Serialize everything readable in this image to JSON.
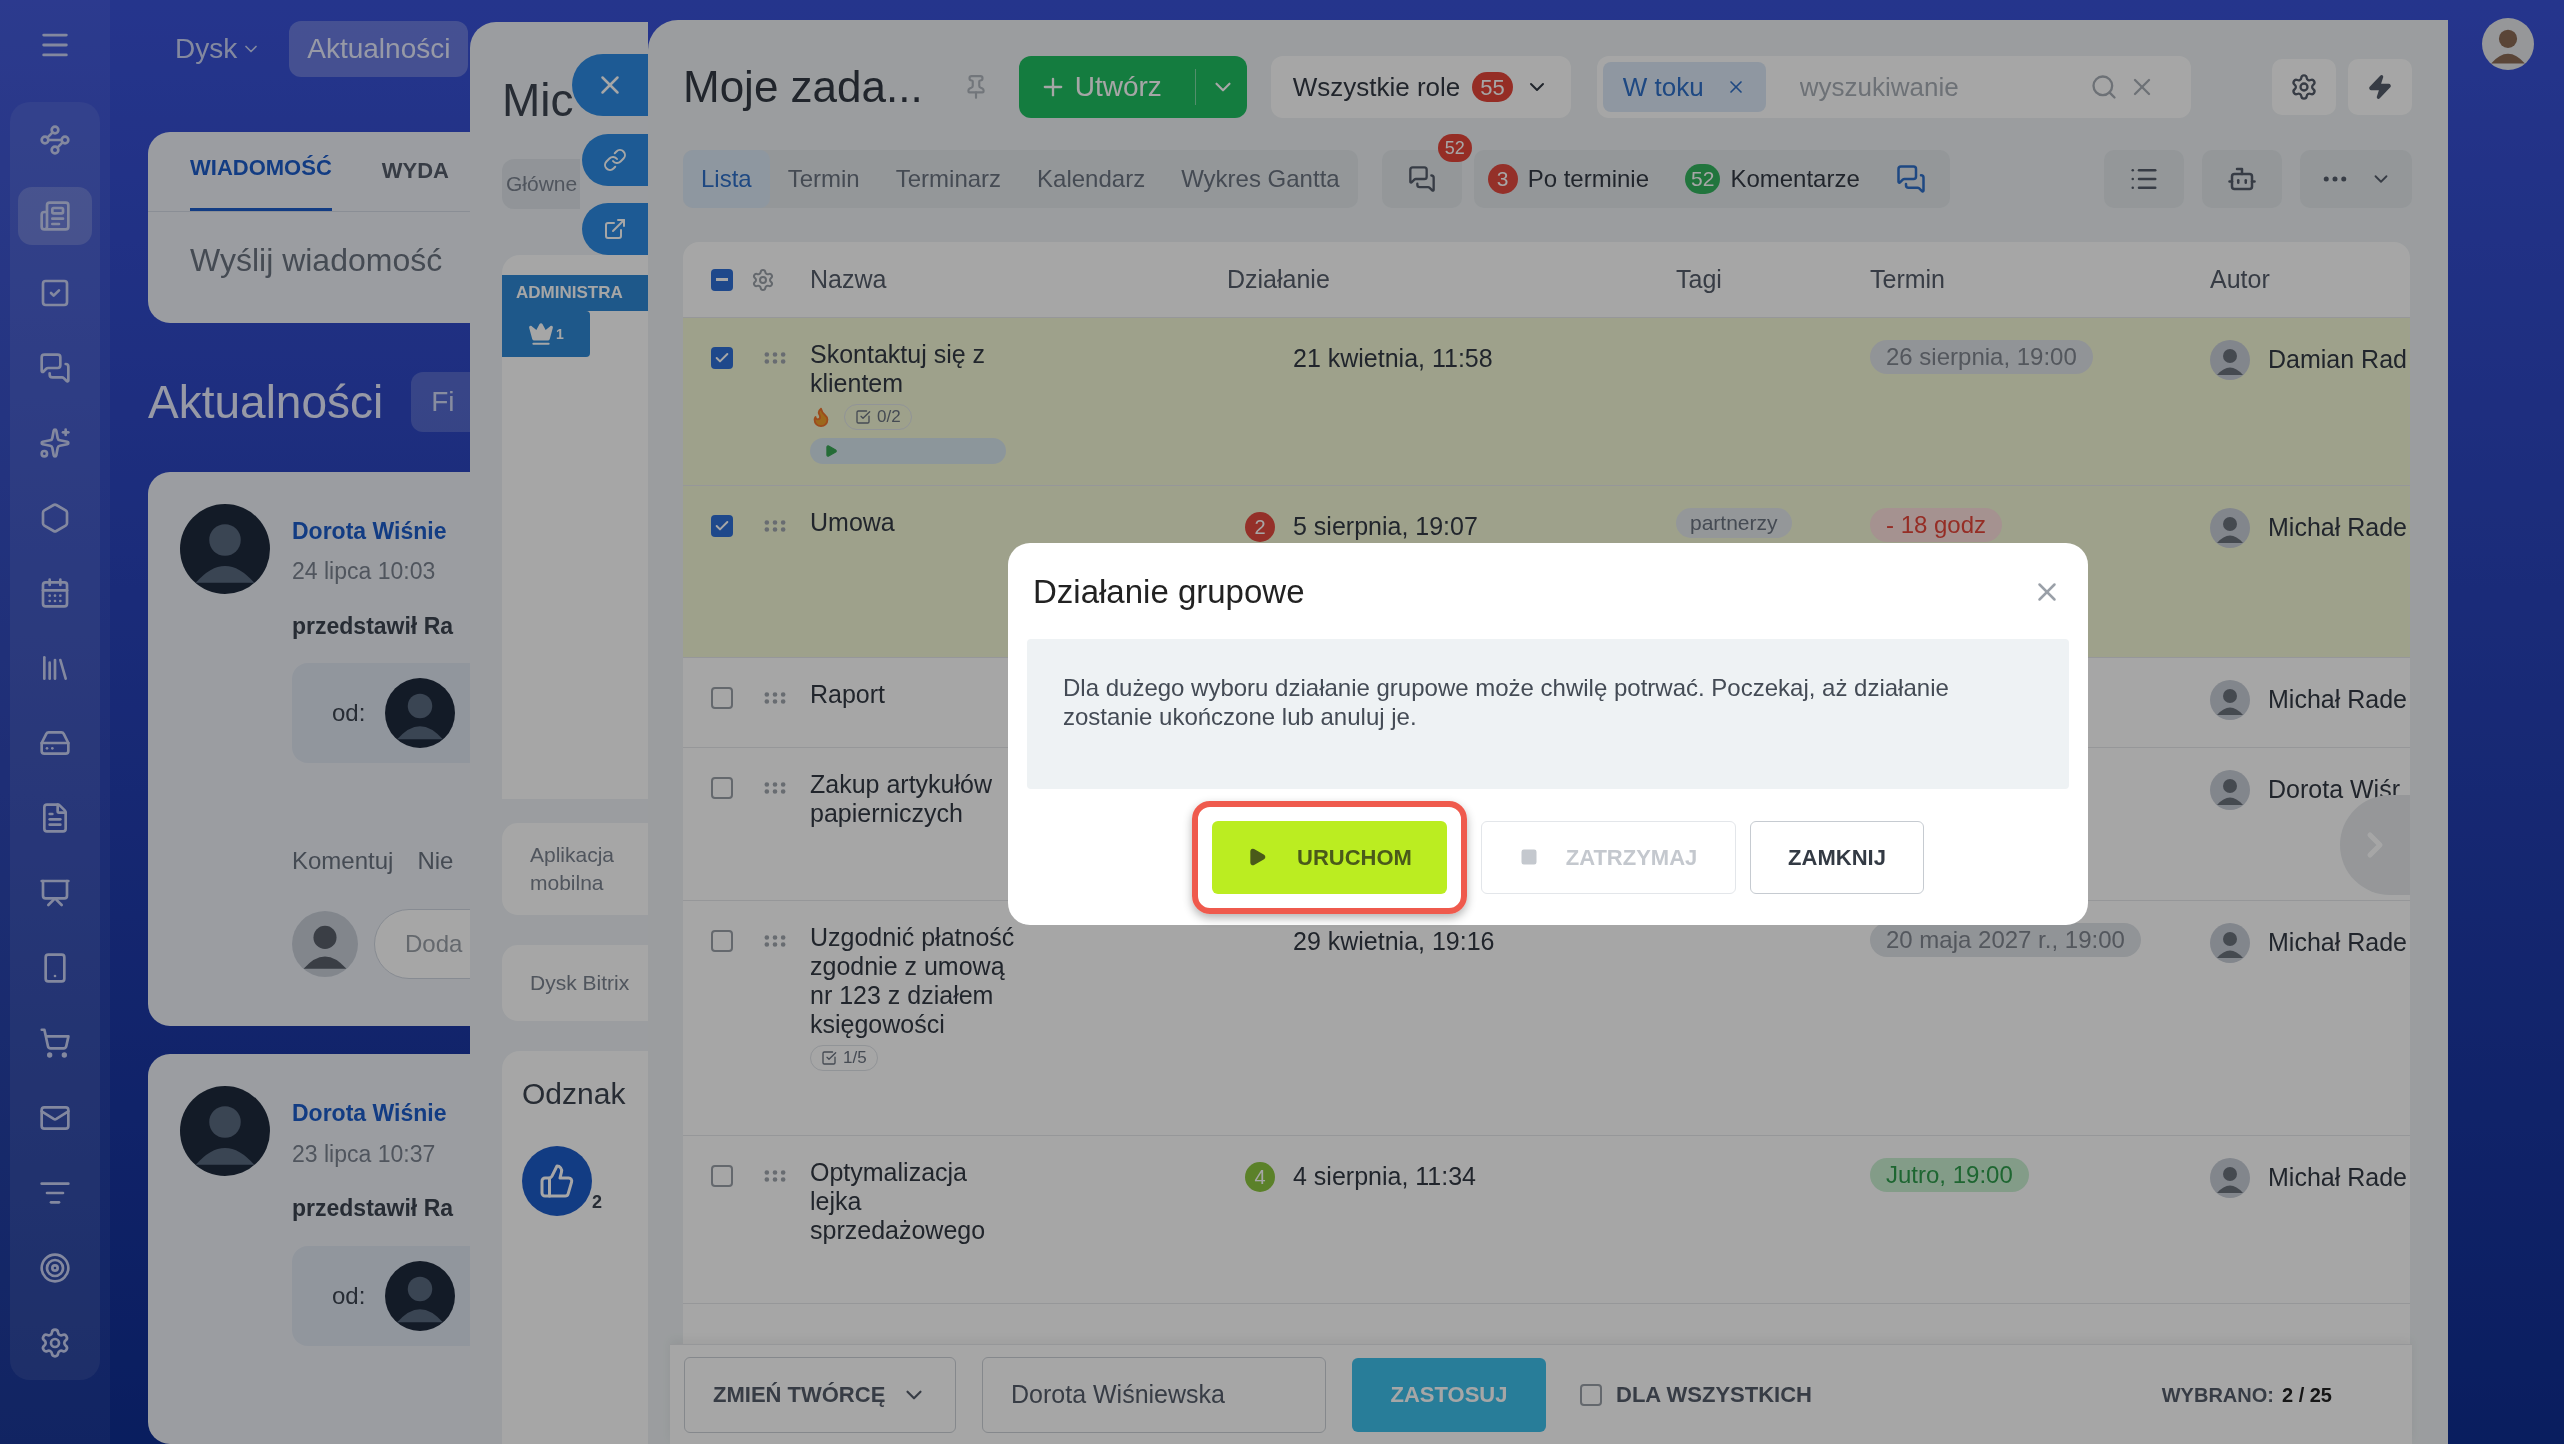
{
  "sidebar": {
    "items": [
      {
        "selected": false
      },
      {
        "selected": true
      },
      {
        "selected": false
      },
      {
        "selected": false
      },
      {
        "selected": false
      },
      {
        "selected": false
      },
      {
        "selected": false
      },
      {
        "selected": false
      },
      {
        "selected": false
      },
      {
        "selected": false
      },
      {
        "selected": false
      },
      {
        "selected": false
      },
      {
        "selected": false
      },
      {
        "selected": false
      },
      {
        "selected": false
      },
      {
        "selected": false
      },
      {
        "selected": false
      }
    ]
  },
  "top_nav": {
    "items": [
      {
        "label": "Dysk",
        "dropdown": true,
        "selected": false
      },
      {
        "label": "Aktualności",
        "dropdown": false,
        "selected": true
      }
    ]
  },
  "composer": {
    "tabs": [
      {
        "label": "WIADOMOŚĆ",
        "selected": true
      },
      {
        "label": "WYDA",
        "selected": false
      }
    ],
    "placeholder": "Wyślij wiadomość"
  },
  "feed": {
    "title": "Aktualności",
    "filter_placeholder": "Fi",
    "posts": [
      {
        "author": "Dorota Wiśnie",
        "date": "24 lipca 10:03",
        "text": "przedstawił Ra",
        "from_label": "od:",
        "actions": [
          "Komentuj",
          "Nie"
        ],
        "comment_placeholder": "Doda"
      },
      {
        "author": "Dorota Wiśnie",
        "date": "23 lipca 10:37",
        "text": "przedstawił Ra",
        "from_label": "od:"
      }
    ]
  },
  "profile_panel": {
    "title": "Mic",
    "tab": "Główne",
    "ribbon": "ADMINISTRA",
    "crown_count": "1",
    "links": [
      "Aplikacja mobilna",
      "Dysk Bitrix"
    ],
    "badges_title": "Odznak",
    "like_count": "2"
  },
  "task_panel": {
    "title": "Moje zada...",
    "create_label": "Utwórz",
    "roles": {
      "label": "Wszystkie role",
      "count": "55"
    },
    "search": {
      "chip": "W toku",
      "placeholder": "wyszukiwanie"
    },
    "views": [
      {
        "label": "Lista",
        "selected": true
      },
      {
        "label": "Termin",
        "selected": false
      },
      {
        "label": "Terminarz",
        "selected": false
      },
      {
        "label": "Kalendarz",
        "selected": false
      },
      {
        "label": "Wykres Gantta",
        "selected": false
      }
    ],
    "chat_count": "52",
    "counters": [
      {
        "count": "3",
        "label": "Po terminie",
        "color": "#943029"
      },
      {
        "count": "52",
        "label": "Komentarze",
        "color": "#22753d"
      }
    ],
    "select_all": {
      "checked": true,
      "indeterminate": true
    },
    "columns": [
      "Nazwa",
      "Działanie",
      "Tagi",
      "Termin",
      "Autor"
    ],
    "rows": [
      {
        "name": "Skontaktuj się z klientem",
        "checked": true,
        "flame": true,
        "checklist": "0/2",
        "timer": true,
        "date": "21 kwietnia, 11:58",
        "deadline": {
          "text": "26 sierpnia, 19:00",
          "kind": "normal"
        },
        "author": "Damian Rad"
      },
      {
        "name": "Umowa",
        "checked": true,
        "counter": {
          "value": "2",
          "color": "#943029"
        },
        "date": "5 sierpnia, 19:07",
        "tag": "partnerzy",
        "deadline": {
          "text": "- 18 godz",
          "kind": "overdue"
        },
        "author": "Michał Rade"
      },
      {
        "name": "Raport",
        "checked": false,
        "author": "Michał Rade"
      },
      {
        "name": "Zakup artykułów papierniczych",
        "checked": false,
        "author": "Dorota Wiśr"
      },
      {
        "name": "Uzgodnić płatność zgodnie z umową nr 123 z działem księgowości",
        "checked": false,
        "checklist": "1/5",
        "date": "29 kwietnia, 19:16",
        "deadline": {
          "text": "20 maja 2027 r., 19:00",
          "kind": "normal"
        },
        "author": "Michał Rade"
      },
      {
        "name": "Optymalizacja lejka sprzedażowego",
        "checked": false,
        "counter": {
          "value": "4",
          "color": "#5b8129"
        },
        "date": "4 sierpnia, 11:34",
        "deadline": {
          "text": "Jutro, 19:00",
          "kind": "soon"
        },
        "author": "Michał Rade"
      }
    ],
    "bottom_bar": {
      "action": "ZMIEŃ TWÓRCĘ",
      "value": "Dorota Wiśniewska",
      "apply": "ZASTOSUJ",
      "for_all": {
        "label": "DLA WSZYSTKICH",
        "checked": false
      },
      "selected_label": "WYBRANO:",
      "selected_count": "2 / 25"
    }
  },
  "dialog": {
    "title": "Działanie grupowe",
    "message": "Dla dużego wyboru działanie grupowe może chwilę potrwać. Poczekaj, aż działanie zostanie ukończone lub anuluj je.",
    "buttons": [
      {
        "label": "URUCHOM",
        "kind": "run",
        "disabled": false,
        "highlighted": true
      },
      {
        "label": "ZATRZYMAJ",
        "kind": "stop",
        "disabled": true,
        "highlighted": false
      },
      {
        "label": "ZAMKNIJ",
        "kind": "close",
        "disabled": false,
        "highlighted": false
      }
    ]
  }
}
